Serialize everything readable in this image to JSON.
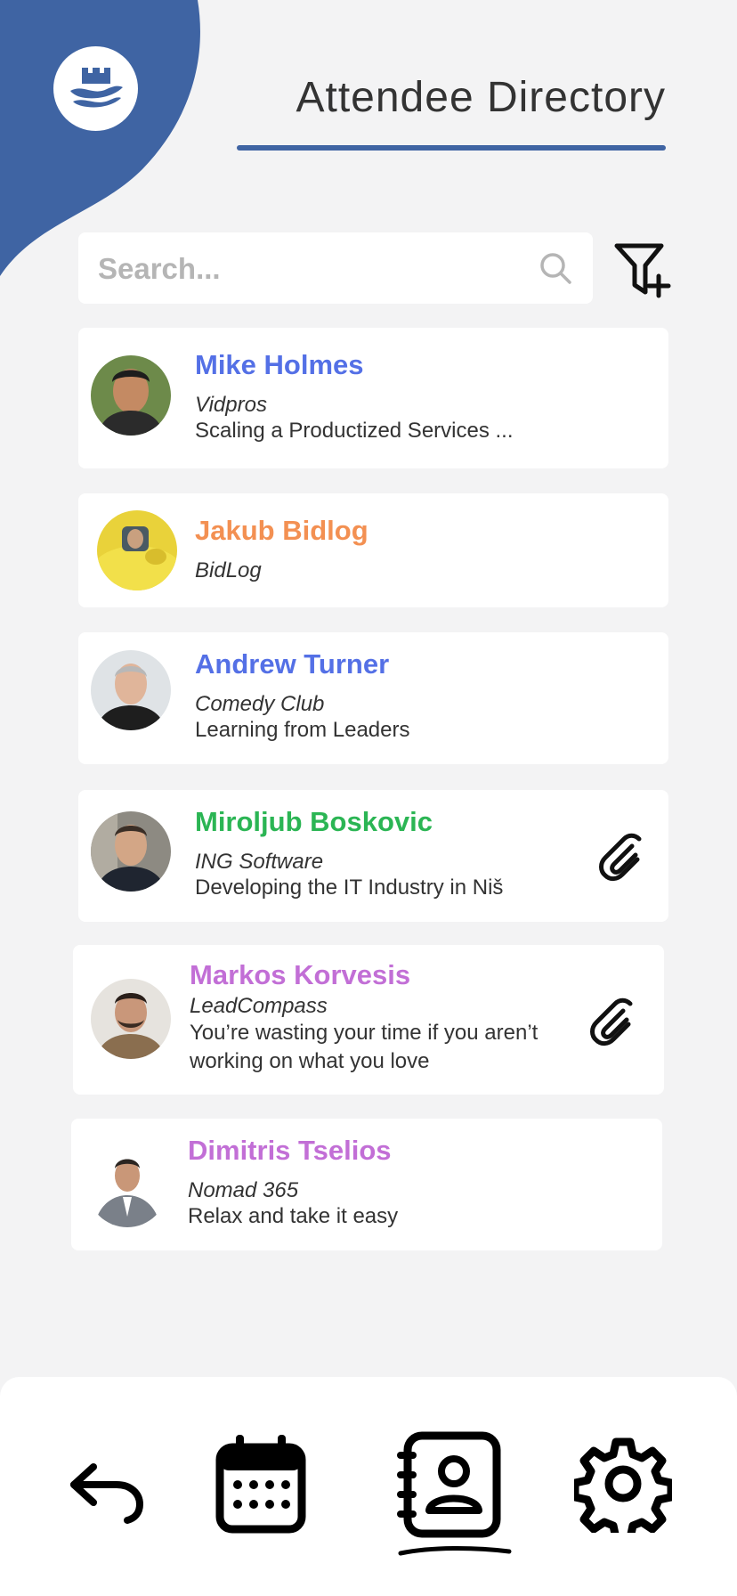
{
  "header": {
    "title": "Attendee Directory",
    "accent_color": "#3f64a3",
    "logo_icon": "castle-waves-icon"
  },
  "search": {
    "placeholder": "Search...",
    "value": "",
    "icon": "search-icon"
  },
  "filter": {
    "icon": "filter-add-icon"
  },
  "attendees": [
    {
      "name": "Mike Holmes",
      "company": "Vidpros",
      "topic": "Scaling a Productized Services ...",
      "name_color": "#5470e6",
      "has_attachment": false
    },
    {
      "name": "Jakub Bidlog",
      "company": "BidLog",
      "topic": "",
      "name_color": "#f39052",
      "has_attachment": false
    },
    {
      "name": "Andrew Turner",
      "company": "Comedy Club",
      "topic": "Learning from Leaders",
      "name_color": "#5470e6",
      "has_attachment": false
    },
    {
      "name": "Miroljub Boskovic",
      "company": "ING Software",
      "topic": "Developing the IT Industry in Niš",
      "name_color": "#2bb554",
      "has_attachment": true
    },
    {
      "name": "Markos Korvesis",
      "company": "LeadCompass",
      "topic": "You’re wasting your time if you aren’t working on what you love",
      "name_color": "#c26fd6",
      "has_attachment": true
    },
    {
      "name": "Dimitris Tselios",
      "company": "Nomad 365",
      "topic": "Relax and take it easy",
      "name_color": "#c26fd6",
      "has_attachment": false
    }
  ],
  "bottom_nav": {
    "items": [
      {
        "icon": "back-arrow-icon",
        "active": false
      },
      {
        "icon": "calendar-icon",
        "active": false
      },
      {
        "icon": "contacts-book-icon",
        "active": true
      },
      {
        "icon": "gear-icon",
        "active": false
      }
    ]
  }
}
